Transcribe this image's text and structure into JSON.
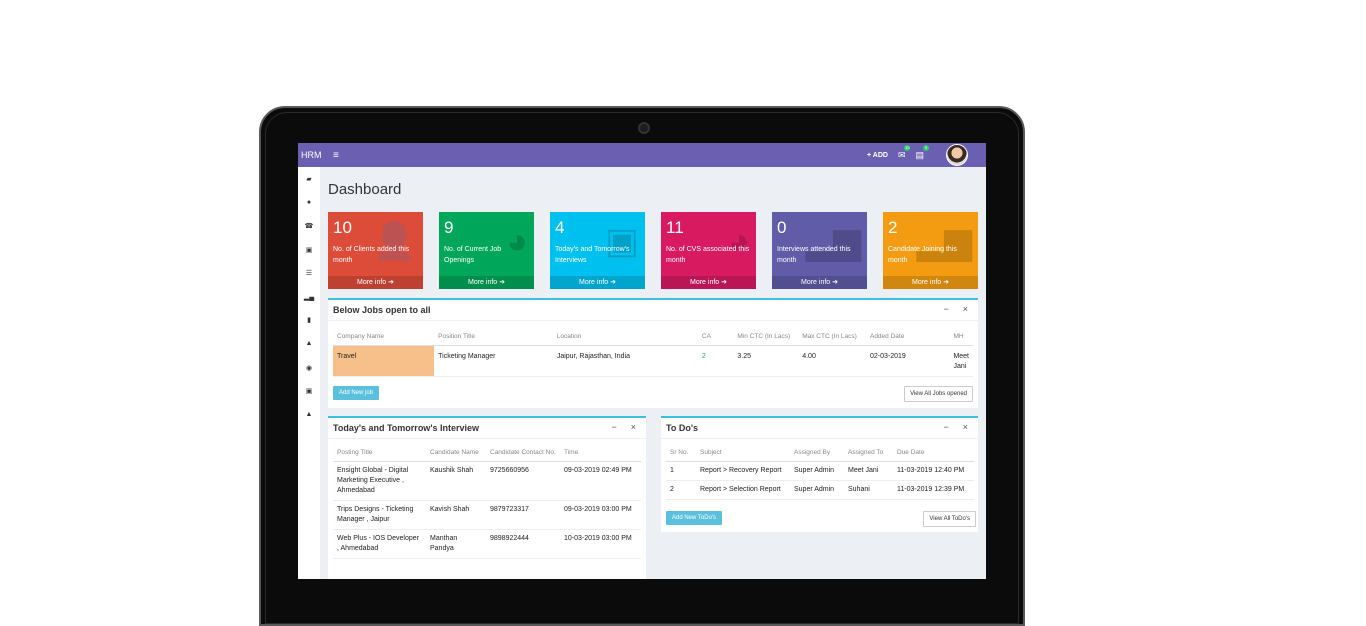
{
  "app": {
    "brand": "HRM",
    "add_label": "+ ADD",
    "mail_badge": "10",
    "task_badge": "9"
  },
  "colors": {
    "topbar": "#6a5fb0",
    "red": "#dd4b39",
    "green": "#00a65a",
    "cyan": "#00c0ef",
    "pink": "#d81b60",
    "purple": "#605ca8",
    "orange": "#f39c12",
    "panel_border": "#3cc0e0",
    "highlight": "#f7c08a"
  },
  "sidebar_icons": [
    "folder-icon",
    "user-icon",
    "phone-icon",
    "money-icon",
    "list-icon",
    "chart-icon",
    "file-icon",
    "graduation-icon",
    "eye-icon",
    "money-icon",
    "lock-icon"
  ],
  "page_title": "Dashboard",
  "stat_boxes": [
    {
      "value": "10",
      "label": "No. of Clients added this month",
      "more": "More info",
      "icon": "user-plus-icon",
      "color": "#dd4b39"
    },
    {
      "value": "9",
      "label": "No. of Current Job Openings",
      "more": "More info",
      "icon": "pie-chart-icon",
      "color": "#00a65a"
    },
    {
      "value": "4",
      "label": "Today's and Tomorrow's Interviews",
      "more": "More info",
      "icon": "briefcase-icon",
      "color": "#00c0ef"
    },
    {
      "value": "11",
      "label": "No. of CVS associated this month",
      "more": "More info",
      "icon": "pie-chart-icon",
      "color": "#d81b60"
    },
    {
      "value": "0",
      "label": "Interviews attended this month",
      "more": "More info",
      "icon": "bar-chart-icon",
      "color": "#605ca8"
    },
    {
      "value": "2",
      "label": "Candidate Joining this month",
      "more": "More info",
      "icon": "bar-chart-icon",
      "color": "#f39c12"
    }
  ],
  "jobs_panel": {
    "title": "Below Jobs open to all",
    "headers": [
      "Company Name",
      "Position Title",
      "Location",
      "CA",
      "Min CTC (In Lacs)",
      "Max CTC (In Lacs)",
      "Added Date",
      "MH"
    ],
    "rows": [
      {
        "company": "Travel",
        "position": "Ticketing Manager",
        "location": "Jaipur, Rajasthan, India",
        "ca": "2",
        "min": "3.25",
        "max": "4.00",
        "date": "02-03-2019",
        "mh": "Meet Jani"
      }
    ],
    "add_button": "Add New job",
    "view_button": "View All Jobs opened"
  },
  "interview_panel": {
    "title": "Today's and Tomorrow's Interview",
    "headers": [
      "Posting Title",
      "Candidate Name",
      "Candidate Contact No.",
      "Time"
    ],
    "rows": [
      {
        "title": "Ensight Global - Digital Marketing Executive , Ahmedabad",
        "name": "Kaushik Shah",
        "contact": "9725660956",
        "time": "09-03-2019 02:49 PM"
      },
      {
        "title": "Trips Designs - Ticketing Manager , Jaipur",
        "name": "Kavish Shah",
        "contact": "9879723317",
        "time": "09-03-2019 03:00 PM"
      },
      {
        "title": "Web Plus - IOS Developer , Ahmedabad",
        "name": "Manthan Pandya",
        "contact": "9898922444",
        "time": "10-03-2019 03:00 PM"
      }
    ]
  },
  "todo_panel": {
    "title": "To Do's",
    "headers": [
      "Sr No.",
      "Subject",
      "Assigned By",
      "Assigned To",
      "Due Date"
    ],
    "rows": [
      {
        "sr": "1",
        "subject": "Report > Recovery Report",
        "by": "Super Admin",
        "to": "Meet Jani",
        "due": "11-03-2019 12:40 PM"
      },
      {
        "sr": "2",
        "subject": "Report > Selection Report",
        "by": "Super Admin",
        "to": "Suhani",
        "due": "11-03-2019 12:39 PM"
      }
    ],
    "add_button": "Add New ToDo's",
    "view_button": "View All ToDo's"
  },
  "panel_tools": {
    "minimize": "−",
    "close": "×"
  }
}
